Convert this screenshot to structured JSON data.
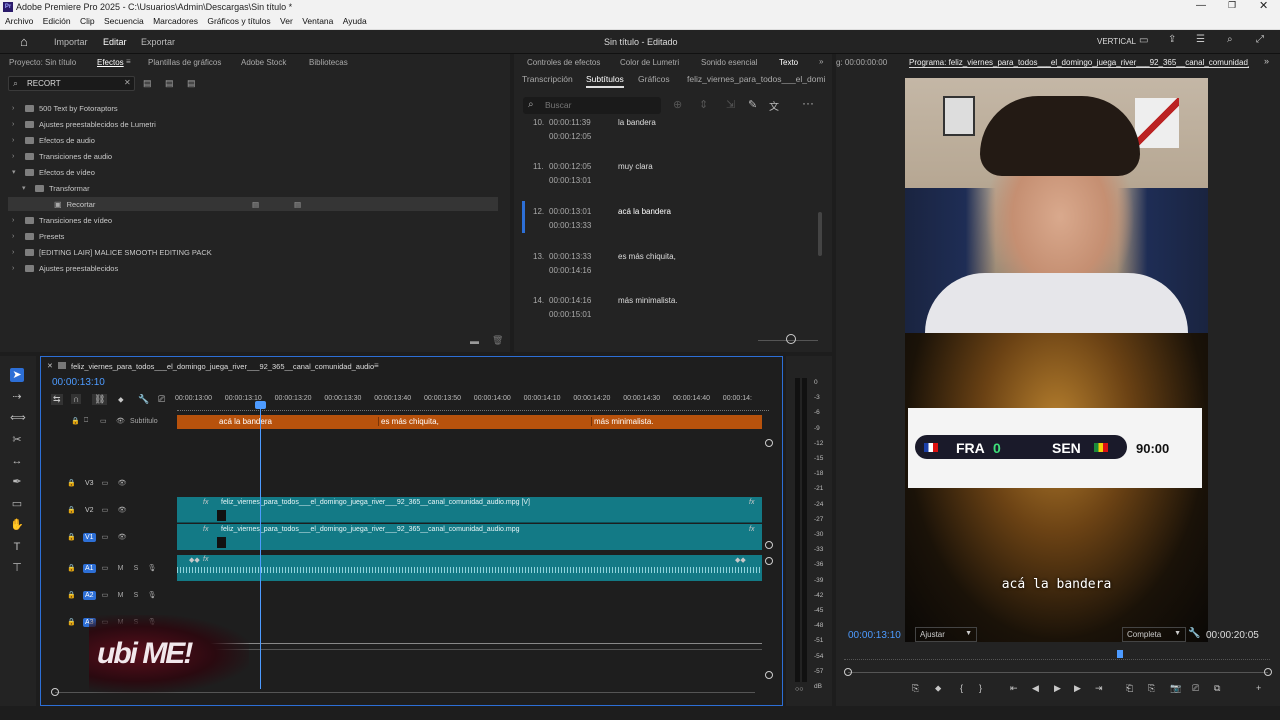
{
  "window": {
    "title": "Adobe Premiere Pro 2025 - C:\\Usuarios\\Admin\\Descargas\\Sin título *"
  },
  "menu": [
    "Archivo",
    "Edición",
    "Clip",
    "Secuencia",
    "Marcadores",
    "Gráficos y títulos",
    "Ver",
    "Ventana",
    "Ayuda"
  ],
  "header": {
    "nav": [
      "Importar",
      "Editar",
      "Exportar"
    ],
    "project_title": "Sin título - Editado",
    "layout_label": "VERTICAL"
  },
  "effects_panel": {
    "tabs": [
      "Proyecto: Sin título",
      "Efectos",
      "Plantillas de gráficos",
      "Adobe Stock",
      "Bibliotecas"
    ],
    "search_value": "RECORT",
    "tree": [
      {
        "label": "500 Text by Fotoraptors",
        "level": 0,
        "expanded": false
      },
      {
        "label": "Ajustes preestablecidos de Lumetri",
        "level": 0,
        "expanded": false
      },
      {
        "label": "Efectos de audio",
        "level": 0,
        "expanded": false
      },
      {
        "label": "Transiciones de audio",
        "level": 0,
        "expanded": false
      },
      {
        "label": "Efectos de vídeo",
        "level": 0,
        "expanded": true
      },
      {
        "label": "Transformar",
        "level": 1,
        "expanded": true
      },
      {
        "label": "Recortar",
        "level": 2,
        "expanded": false
      },
      {
        "label": "Transiciones de vídeo",
        "level": 0,
        "expanded": false
      },
      {
        "label": "Presets",
        "level": 0,
        "expanded": false
      },
      {
        "label": "[EDITING LAIR] MALICE SMOOTH EDITING PACK",
        "level": 0,
        "expanded": false
      },
      {
        "label": "Ajustes preestablecidos",
        "level": 0,
        "expanded": false
      }
    ]
  },
  "text_panel": {
    "tabs": [
      "Controles de efectos",
      "Color de Lumetri",
      "Sonido esencial",
      "Texto"
    ],
    "subtabs": [
      "Transcripción",
      "Subtítulos",
      "Gráficos",
      "feliz_viernes_para_todos___el_domi"
    ],
    "search_placeholder": "Buscar",
    "captions": [
      {
        "num": "10.",
        "start": "00:00:11:39",
        "end": "00:00:12:05",
        "text": "la bandera"
      },
      {
        "num": "11.",
        "start": "00:00:12:05",
        "end": "00:00:13:01",
        "text": "muy clara"
      },
      {
        "num": "12.",
        "start": "00:00:13:01",
        "end": "00:00:13:33",
        "text": "acá la bandera"
      },
      {
        "num": "13.",
        "start": "00:00:13:33",
        "end": "00:00:14:16",
        "text": "es más chiquita,"
      },
      {
        "num": "14.",
        "start": "00:00:14:16",
        "end": "00:00:15:01",
        "text": "más minimalista."
      }
    ]
  },
  "program_monitor": {
    "source_tc": "g: 00:00:00:00",
    "title": "Programa: feliz_viernes_para_todos___el_domingo_juega_river___92_365__canal_comunidad_audio",
    "current_tc": "00:00:13:10",
    "fit": "Ajustar",
    "quality": "Completa",
    "duration": "00:00:20:05",
    "caption_overlay": "acá la bandera",
    "scoreboard": {
      "team1": "FRA",
      "score1": "0",
      "team2": "SEN",
      "time": "90:00"
    }
  },
  "timeline": {
    "sequence_name": "feliz_viernes_para_todos___el_domingo_juega_river___92_365__canal_comunidad_audio",
    "timecode": "00:00:13:10",
    "ruler": [
      "00:00:13:00",
      "00:00:13:10",
      "00:00:13:20",
      "00:00:13:30",
      "00:00:13:40",
      "00:00:13:50",
      "00:00:14:00",
      "00:00:14:10",
      "00:00:14:20",
      "00:00:14:30",
      "00:00:14:40",
      "00:00:14:"
    ],
    "subtitle_track_label": "Subtítulo",
    "subtitle_clips": [
      "acá la bandera",
      "es más chiquita,",
      "más minimalista."
    ],
    "tracks": [
      "V3",
      "V2",
      "V1",
      "A1",
      "A2",
      "A3"
    ],
    "v2_clip": "feliz_viernes_para_todos___el_domingo_juega_river___92_365__canal_comunidad_audio.mpg [V]",
    "v1_clip": "feliz_viernes_para_todos___el_domingo_juega_river___92_365__canal_comunidad_audio.mpg",
    "watermark": "ubi ME!"
  },
  "meter": {
    "labels": [
      "0",
      "-3",
      "-6",
      "-9",
      "-12",
      "-15",
      "-18",
      "-21",
      "-24",
      "-27",
      "-30",
      "-33",
      "-36",
      "-39",
      "-42",
      "-45",
      "-48",
      "-51",
      "-54",
      "-57",
      "dB"
    ]
  },
  "colors": {
    "accent": "#2d6fd6",
    "subtitle_clip": "#b8520c",
    "video_clip": "#137a86",
    "audio_clip": "#137a86"
  }
}
